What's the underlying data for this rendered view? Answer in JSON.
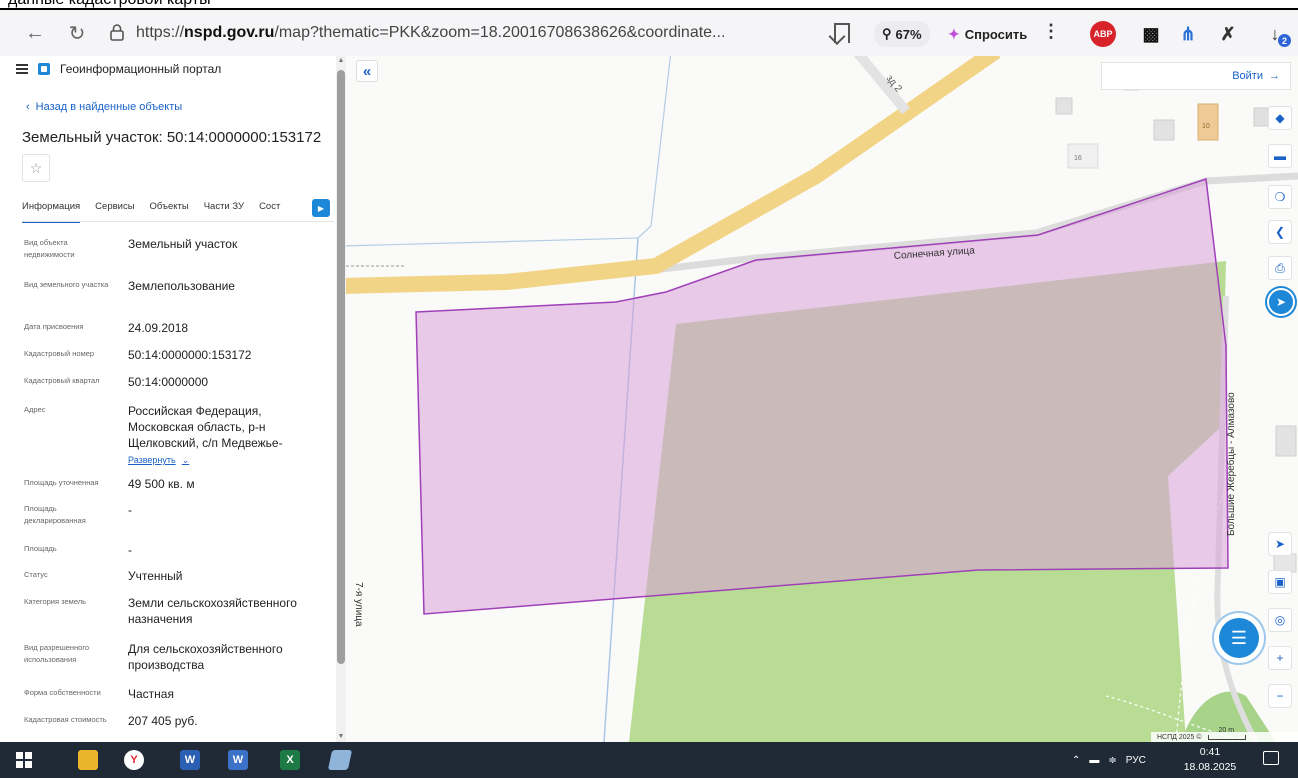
{
  "caption": {
    "text": "данные кадастровой карты"
  },
  "browser": {
    "url_prefix": "https://",
    "url_host": "nspd.gov.ru",
    "url_rest": "/map?thematic=PKK&zoom=18.20016708638626&coordinate...",
    "zoom": "67%",
    "ask": "Спросить",
    "extensions": {
      "abp": "ABP",
      "downloads_badge": "2"
    }
  },
  "panel": {
    "portal_name": "Геоинформационный портал",
    "back_link": "Назад в найденные объекты",
    "title": "Земельный участок: 50:14:0000000:153172",
    "tabs": [
      "Информация",
      "Сервисы",
      "Объекты",
      "Части ЗУ",
      "Сост"
    ],
    "rows": [
      {
        "label": "Вид объекта недвижимости",
        "value": "Земельный участок"
      },
      {
        "label": "Вид земельного участка",
        "value": "Землепользование"
      },
      {
        "label": "Дата присвоения",
        "value": "24.09.2018"
      },
      {
        "label": "Кадастровый номер",
        "value": "50:14:0000000:153172"
      },
      {
        "label": "Кадастровый квартал",
        "value": "50:14:0000000"
      },
      {
        "label": "Адрес",
        "value": "Российская Федерация, Московская область, р-н Щелковский, с/п Медвежье-",
        "more": "Развернуть"
      },
      {
        "label": "Площадь уточненная",
        "value": "49 500 кв. м"
      },
      {
        "label": "Площадь декларированная",
        "value": "-"
      },
      {
        "label": "Площадь",
        "value": "-"
      },
      {
        "label": "Статус",
        "value": "Учтенный"
      },
      {
        "label": "Категория земель",
        "value": "Земли сельскохозяйственного назначения"
      },
      {
        "label": "Вид разрешенного использования",
        "value": "Для сельскохозяйственного производства"
      },
      {
        "label": "Форма собственности",
        "value": "Частная"
      },
      {
        "label": "Кадастровая стоимость",
        "value": "207 405 руб."
      }
    ]
  },
  "map": {
    "login": "Войти",
    "labels": {
      "street_top": "зд 2",
      "solnechnaya": "Солнечная улица",
      "seventh": "7-я улица",
      "bolshie": "Большие Жеребцы - Алмазово",
      "house_16": "16",
      "house_10": "10"
    },
    "scale": {
      "copyright": "НСПД 2025 ©",
      "distance": "20 m"
    },
    "colors": {
      "parcel_fill": "#e6bfe6",
      "parcel_stroke": "#a040b8",
      "field": "#b8dc94",
      "road": "#f8d888"
    }
  },
  "taskbar": {
    "lang": "РУС",
    "time": "0:41",
    "date": "18.08.2025",
    "apps": [
      "windows-start",
      "file-explorer",
      "yandex-browser",
      "word",
      "word-viewer",
      "excel",
      "notes"
    ]
  }
}
